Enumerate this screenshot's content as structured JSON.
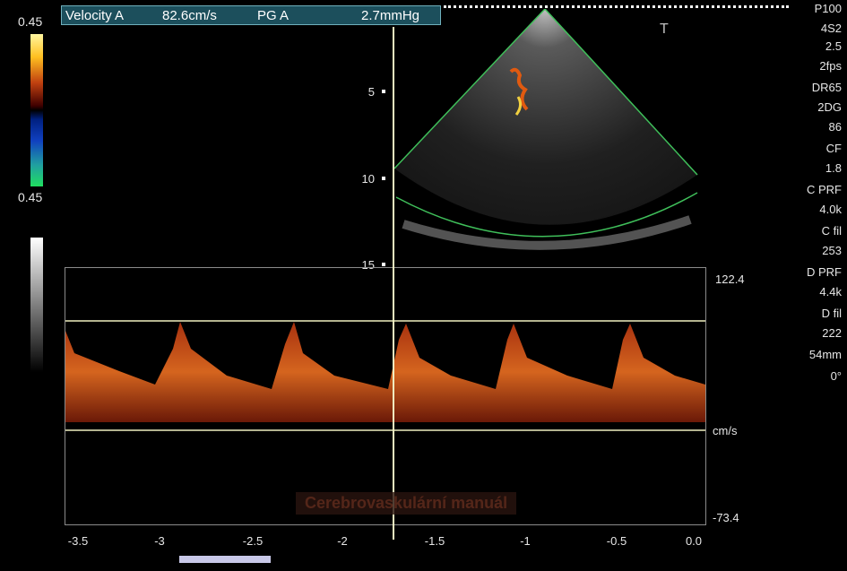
{
  "measurement": {
    "velocity_label": "Velocity A",
    "velocity_value": "82.6cm/s",
    "pg_label": "PG A",
    "pg_value": "2.7mmHg"
  },
  "color_scale": {
    "top": "0.45",
    "bottom": "0.45"
  },
  "params": [
    "P100",
    "4S2",
    "2.5",
    "2fps",
    "DR65",
    "2DG",
    "86",
    "CF",
    "1.8",
    "C PRF",
    "4.0k",
    "C fil",
    "253",
    "D PRF",
    "4.4k",
    "D fil",
    "222",
    "54mm",
    "0°"
  ],
  "depth_marks": [
    "5",
    "10",
    "15"
  ],
  "orientation_marker": "T",
  "spectrum": {
    "velocity_max": "122.4",
    "velocity_unit": "cm/s",
    "velocity_min": "-73.4",
    "time_ticks": [
      "-3.5",
      "-3",
      "-2.5",
      "-2",
      "-1.5",
      "-1",
      "-0.5",
      "0.0"
    ]
  },
  "watermark": "Cerebrovaskulární manuál",
  "colors": {
    "accent_teal": "#1c4f5c",
    "caliper": "#f0f0c0",
    "sector_outline": "#3fbf5a"
  }
}
